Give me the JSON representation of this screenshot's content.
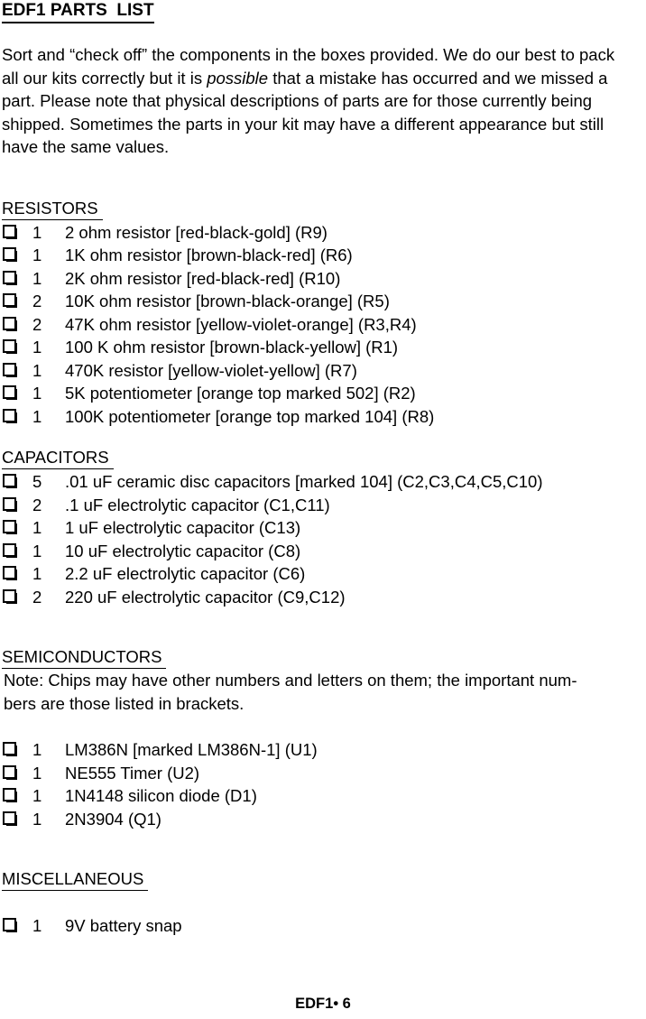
{
  "document": {
    "title": "EDF1 PARTS  LIST",
    "intro_before_italic": "Sort and “check off” the components in the boxes provided. We do our best to pack all our kits correctly but it is ",
    "intro_italic": "possible",
    "intro_after_italic": " that a mistake has occurred and we missed a part. Please note that physical descriptions of parts are for those currently being shipped. Sometimes the parts in your kit may have a different appearance but still have the same values.",
    "footer": "EDF1• 6"
  },
  "icons": {
    "checkbox": "shadowed-checkbox"
  },
  "sections": [
    {
      "heading": "RESISTORS",
      "note": null,
      "items": [
        {
          "qty": "1",
          "desc": "2 ohm resistor [red-black-gold] (R9)"
        },
        {
          "qty": "1",
          "desc": "1K ohm resistor [brown-black-red] (R6)"
        },
        {
          "qty": "1",
          "desc": "2K ohm resistor [red-black-red] (R10)"
        },
        {
          "qty": "2",
          "desc": "10K ohm resistor [brown-black-orange] (R5)"
        },
        {
          "qty": "2",
          "desc": "47K ohm resistor [yellow-violet-orange] (R3,R4)"
        },
        {
          "qty": "1",
          "desc": "100 K ohm resistor [brown-black-yellow] (R1)"
        },
        {
          "qty": "1",
          "desc": "470K resistor [yellow-violet-yellow] (R7)"
        },
        {
          "qty": "1",
          "desc": "5K potentiometer [orange top marked 502] (R2)"
        },
        {
          "qty": "1",
          "desc": "100K potentiometer [orange top marked 104] (R8)"
        }
      ]
    },
    {
      "heading": "CAPACITORS",
      "note": null,
      "items": [
        {
          "qty": "5",
          "desc": ".01 uF ceramic disc capacitors [marked 104] (C2,C3,C4,C5,C10)"
        },
        {
          "qty": "2",
          "desc": ".1 uF electrolytic capacitor (C1,C11)"
        },
        {
          "qty": "1",
          "desc": "1 uF electrolytic capacitor (C13)"
        },
        {
          "qty": "1",
          "desc": "10 uF electrolytic capacitor (C8)"
        },
        {
          "qty": "1",
          "desc": "2.2 uF electrolytic capacitor (C6)"
        },
        {
          "qty": "2",
          "desc": "220 uF electrolytic capacitor (C9,C12)"
        }
      ]
    },
    {
      "heading": "SEMICONDUCTORS",
      "note": "Note: Chips may have other numbers and letters on them; the important num-\nbers are those listed in brackets.",
      "items": [
        {
          "qty": "1",
          "desc": "LM386N [marked LM386N-1] (U1)"
        },
        {
          "qty": "1",
          "desc": "NE555 Timer (U2)"
        },
        {
          "qty": "1",
          "desc": "1N4148 silicon diode (D1)"
        },
        {
          "qty": "1",
          "desc": "2N3904 (Q1)"
        }
      ]
    },
    {
      "heading": "MISCELLANEOUS",
      "note": null,
      "items": [
        {
          "qty": "1",
          "desc": "9V battery snap"
        }
      ]
    }
  ]
}
